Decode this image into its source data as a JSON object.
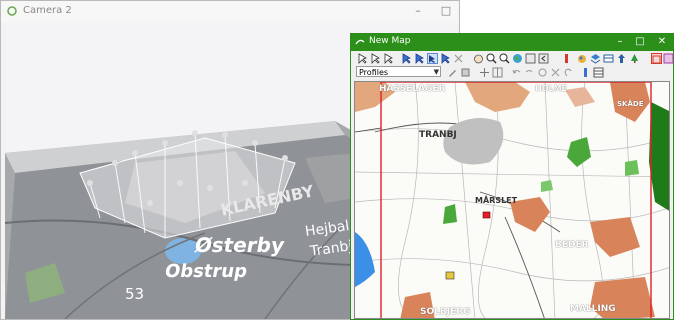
{
  "camera_window": {
    "title": "Camera 2",
    "controls": [
      "–",
      "□"
    ],
    "scene_labels": [
      "Østerby",
      "Obstrup",
      "Hejbal",
      "Tranbj",
      "KLARENBY",
      "53"
    ]
  },
  "map_window": {
    "title": "New Map",
    "controls": [
      "–",
      "□",
      "✕"
    ],
    "layer_select": "Profiles",
    "map_labels": [
      "HASSELAGER",
      "HOLME",
      "TRANBJ",
      "MÅRSLET",
      "BEDER",
      "SOLBJERG",
      "MALLING",
      "SKÅDE"
    ]
  },
  "colors": {
    "map_titlebar": "#2b8f19",
    "urban": "#d9835a",
    "forest": "#3f9e2f",
    "water": "#4aa0e8",
    "lake": "#bdbdbd",
    "profile_line": "#e0202a"
  }
}
